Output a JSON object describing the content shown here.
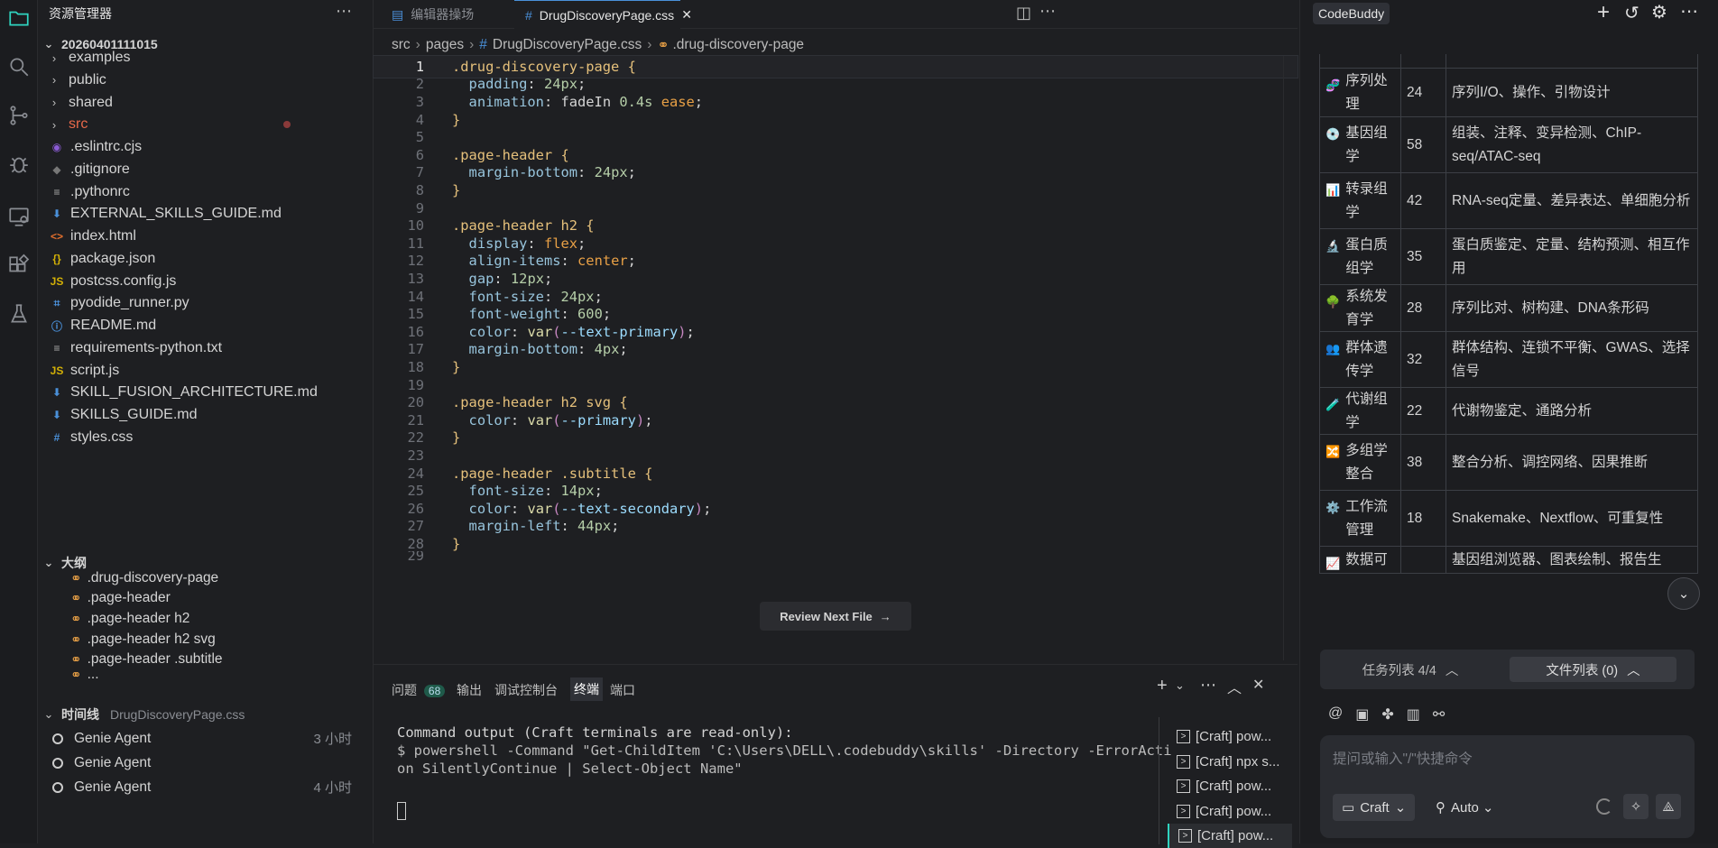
{
  "activity_bar": {
    "icons": [
      "files-icon",
      "search-icon",
      "source-control-icon",
      "debug-icon",
      "remote-icon",
      "extensions-icon",
      "flask-icon"
    ]
  },
  "explorer": {
    "title": "资源管理器",
    "root": "20260401111015",
    "items": [
      {
        "label": "examples",
        "kind": "folder"
      },
      {
        "label": "public",
        "kind": "folder"
      },
      {
        "label": "shared",
        "kind": "folder"
      },
      {
        "label": "src",
        "kind": "folder"
      },
      {
        "label": ".eslintrc.cjs",
        "kind": "eslint"
      },
      {
        "label": ".gitignore",
        "kind": "git"
      },
      {
        "label": ".pythonrc",
        "kind": "text"
      },
      {
        "label": "EXTERNAL_SKILLS_GUIDE.md",
        "kind": "md"
      },
      {
        "label": "index.html",
        "kind": "html"
      },
      {
        "label": "package.json",
        "kind": "json"
      },
      {
        "label": "postcss.config.js",
        "kind": "js"
      },
      {
        "label": "pyodide_runner.py",
        "kind": "py"
      },
      {
        "label": "README.md",
        "kind": "info"
      },
      {
        "label": "requirements-python.txt",
        "kind": "text"
      },
      {
        "label": "script.js",
        "kind": "js"
      },
      {
        "label": "SKILL_FUSION_ARCHITECTURE.md",
        "kind": "md"
      },
      {
        "label": "SKILLS_GUIDE.md",
        "kind": "md"
      },
      {
        "label": "styles.css",
        "kind": "css"
      }
    ],
    "outline_title": "大纲",
    "outline": [
      ".drug-discovery-page",
      ".page-header",
      ".page-header h2",
      ".page-header h2 svg",
      ".page-header .subtitle",
      "..."
    ],
    "timeline_title": "时间线",
    "timeline_file": "DrugDiscoveryPage.css",
    "timeline": [
      {
        "label": "Genie Agent",
        "time": "3 小时"
      },
      {
        "label": "Genie Agent",
        "time": ""
      },
      {
        "label": "Genie Agent",
        "time": "4 小时"
      }
    ]
  },
  "editor": {
    "tabs": [
      {
        "label": "编辑器操场",
        "active": false
      },
      {
        "label": "DrugDiscoveryPage.css",
        "active": true
      }
    ],
    "breadcrumb": [
      "src",
      "pages",
      "DrugDiscoveryPage.css",
      ".drug-discovery-page"
    ],
    "review_button": "Review Next File",
    "lines": [
      ".drug-discovery-page {",
      "  padding: 24px;",
      "  animation: fadeIn 0.4s ease;",
      "}",
      "",
      ".page-header {",
      "  margin-bottom: 24px;",
      "}",
      "",
      ".page-header h2 {",
      "  display: flex;",
      "  align-items: center;",
      "  gap: 12px;",
      "  font-size: 24px;",
      "  font-weight: 600;",
      "  color: var(--text-primary);",
      "  margin-bottom: 4px;",
      "}",
      "",
      ".page-header h2 svg {",
      "  color: var(--primary);",
      "}",
      "",
      ".page-header .subtitle {",
      "  font-size: 14px;",
      "  color: var(--text-secondary);",
      "  margin-left: 44px;",
      "}"
    ]
  },
  "panel": {
    "tabs": [
      "问题",
      "输出",
      "调试控制台",
      "终端",
      "端口"
    ],
    "problems_count": "68",
    "active_tab": "终端",
    "terminal_lines": [
      "Command output (Craft terminals are read-only):",
      "$ powershell -Command \"Get-ChildItem 'C:\\Users\\DELL\\.codebuddy\\skills' -Directory -ErrorActi",
      "on SilentlyContinue | Select-Object Name\""
    ],
    "terminals": [
      "[Craft] pow...",
      "[Craft] npx s...",
      "[Craft] pow...",
      "[Craft] pow...",
      "[Craft] pow..."
    ]
  },
  "codebuddy": {
    "title": "CodeBuddy",
    "table": [
      {
        "icon": "🧬",
        "name": "序列处理",
        "count": "24",
        "desc": "序列I/O、操作、引物设计"
      },
      {
        "icon": "💿",
        "name": "基因组学",
        "count": "58",
        "desc": "组装、注释、变异检测、ChIP-seq/ATAC-seq"
      },
      {
        "icon": "📊",
        "name": "转录组学",
        "count": "42",
        "desc": "RNA-seq定量、差异表达、单细胞分析"
      },
      {
        "icon": "🔬",
        "name": "蛋白质组学",
        "count": "35",
        "desc": "蛋白质鉴定、定量、结构预测、相互作用"
      },
      {
        "icon": "🌳",
        "name": "系统发育学",
        "count": "28",
        "desc": "序列比对、树构建、DNA条形码"
      },
      {
        "icon": "👥",
        "name": "群体遗传学",
        "count": "32",
        "desc": "群体结构、连锁不平衡、GWAS、选择信号"
      },
      {
        "icon": "🧪",
        "name": "代谢组学",
        "count": "22",
        "desc": "代谢物鉴定、通路分析"
      },
      {
        "icon": "🔀",
        "name": "多组学整合",
        "count": "38",
        "desc": "整合分析、调控网络、因果推断"
      },
      {
        "icon": "⚙️",
        "name": "工作流管理",
        "count": "18",
        "desc": "Snakemake、Nextflow、可重复性"
      },
      {
        "icon": "📈",
        "name": "数据可",
        "count": "",
        "desc": "基因组浏览器、图表绘制、报告生"
      }
    ],
    "task_list": "任务列表 4/4",
    "file_list": "文件列表 (0)",
    "input_placeholder": "提问或输入\"/\"快捷命令",
    "mode": "Craft",
    "model": "Auto"
  }
}
